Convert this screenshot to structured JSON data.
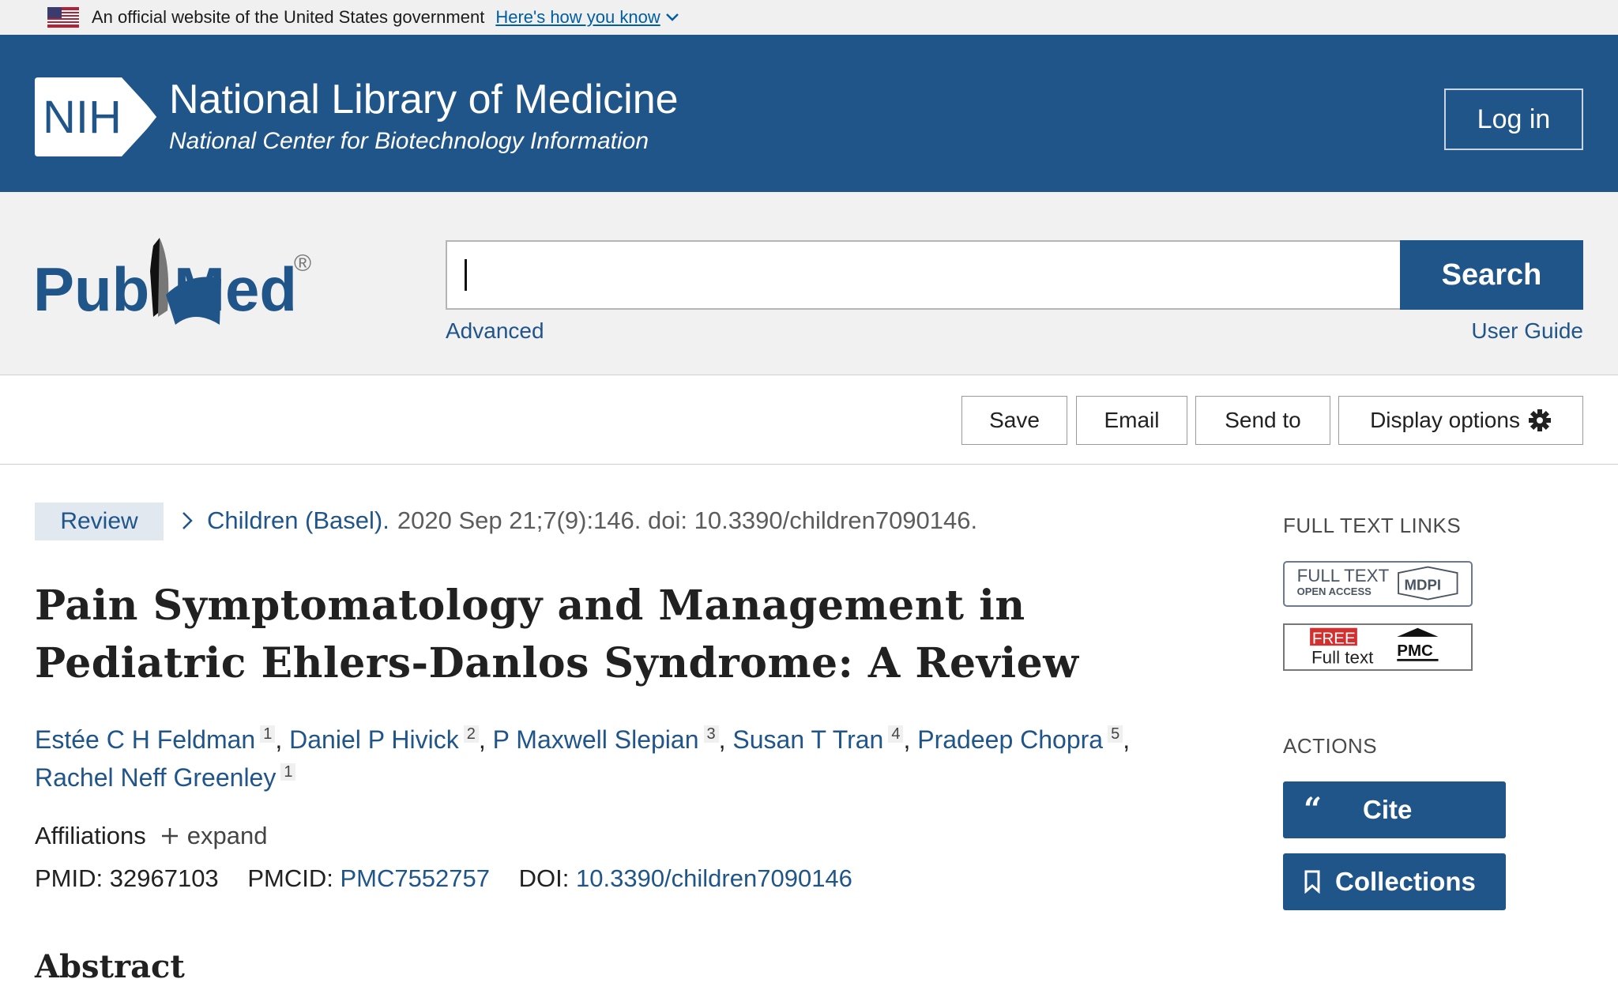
{
  "gov_banner": {
    "text": "An official website of the United States government",
    "link": "Here's how you know"
  },
  "nih_header": {
    "logo_text": "NIH",
    "title": "National Library of Medicine",
    "subtitle": "National Center for Biotechnology Information",
    "login": "Log in"
  },
  "search": {
    "logo_text_pub": "Pub",
    "logo_text_med": "Med",
    "logo_mark": "®",
    "input_value": "",
    "button": "Search",
    "advanced": "Advanced",
    "user_guide": "User Guide"
  },
  "toolbar": {
    "save": "Save",
    "email": "Email",
    "send_to": "Send to",
    "display_options": "Display options"
  },
  "article": {
    "type_badge": "Review",
    "journal": "Children (Basel).",
    "citation": "2020 Sep 21;7(9):146. doi: 10.3390/children7090146.",
    "title": "Pain Symptomatology and Management in Pediatric Ehlers-Danlos Syndrome: A Review",
    "authors": [
      {
        "name": "Estée C H Feldman",
        "aff": "1"
      },
      {
        "name": "Daniel P Hivick",
        "aff": "2"
      },
      {
        "name": "P Maxwell Slepian",
        "aff": "3"
      },
      {
        "name": "Susan T Tran",
        "aff": "4"
      },
      {
        "name": "Pradeep Chopra",
        "aff": "5"
      },
      {
        "name": "Rachel Neff Greenley",
        "aff": "1"
      }
    ],
    "affiliations_label": "Affiliations",
    "expand_label": "expand",
    "pmid_label": "PMID:",
    "pmid": "32967103",
    "pmcid_label": "PMCID:",
    "pmcid": "PMC7552757",
    "doi_label": "DOI:",
    "doi": "10.3390/children7090146",
    "abstract_heading": "Abstract"
  },
  "sidebar": {
    "full_text_links_heading": "FULL TEXT LINKS",
    "mdpi_full_text": "FULL TEXT",
    "mdpi_open_access": "OPEN ACCESS",
    "mdpi_logo": "MDPI",
    "pmc_free": "FREE",
    "pmc_full_text": "Full text",
    "pmc_logo": "PMC",
    "actions_heading": "ACTIONS",
    "cite": "Cite",
    "collections": "Collections"
  },
  "colors": {
    "nih_blue": "#20558a",
    "link_blue": "#20558a",
    "badge_bg": "#e1e8f0",
    "banner_bg": "#f0f0f0"
  },
  "icons": [
    "us-flag-icon",
    "chevron-down-icon",
    "nih-logo",
    "pubmed-logo",
    "gear-icon",
    "chevron-right-icon",
    "plus-icon",
    "quote-icon",
    "bookmark-icon"
  ]
}
